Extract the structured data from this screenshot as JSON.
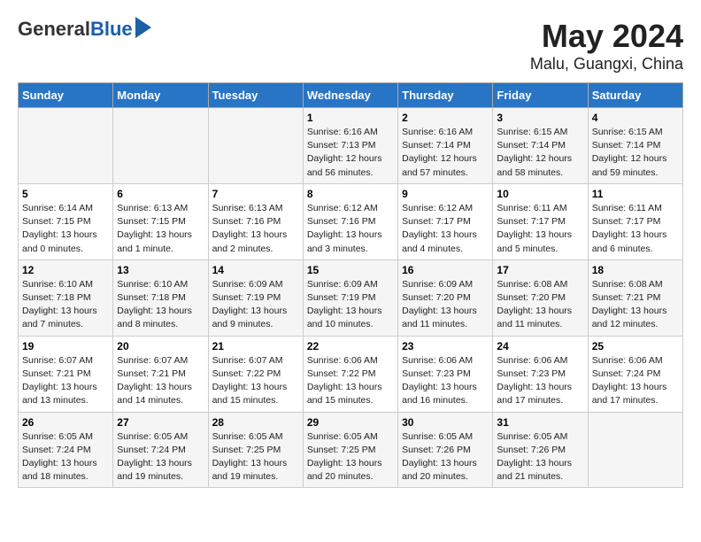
{
  "header": {
    "logo_general": "General",
    "logo_blue": "Blue",
    "title": "May 2024",
    "location": "Malu, Guangxi, China"
  },
  "weekdays": [
    "Sunday",
    "Monday",
    "Tuesday",
    "Wednesday",
    "Thursday",
    "Friday",
    "Saturday"
  ],
  "weeks": [
    [
      {
        "day": "",
        "info": ""
      },
      {
        "day": "",
        "info": ""
      },
      {
        "day": "",
        "info": ""
      },
      {
        "day": "1",
        "info": "Sunrise: 6:16 AM\nSunset: 7:13 PM\nDaylight: 12 hours\nand 56 minutes."
      },
      {
        "day": "2",
        "info": "Sunrise: 6:16 AM\nSunset: 7:14 PM\nDaylight: 12 hours\nand 57 minutes."
      },
      {
        "day": "3",
        "info": "Sunrise: 6:15 AM\nSunset: 7:14 PM\nDaylight: 12 hours\nand 58 minutes."
      },
      {
        "day": "4",
        "info": "Sunrise: 6:15 AM\nSunset: 7:14 PM\nDaylight: 12 hours\nand 59 minutes."
      }
    ],
    [
      {
        "day": "5",
        "info": "Sunrise: 6:14 AM\nSunset: 7:15 PM\nDaylight: 13 hours\nand 0 minutes."
      },
      {
        "day": "6",
        "info": "Sunrise: 6:13 AM\nSunset: 7:15 PM\nDaylight: 13 hours\nand 1 minute."
      },
      {
        "day": "7",
        "info": "Sunrise: 6:13 AM\nSunset: 7:16 PM\nDaylight: 13 hours\nand 2 minutes."
      },
      {
        "day": "8",
        "info": "Sunrise: 6:12 AM\nSunset: 7:16 PM\nDaylight: 13 hours\nand 3 minutes."
      },
      {
        "day": "9",
        "info": "Sunrise: 6:12 AM\nSunset: 7:17 PM\nDaylight: 13 hours\nand 4 minutes."
      },
      {
        "day": "10",
        "info": "Sunrise: 6:11 AM\nSunset: 7:17 PM\nDaylight: 13 hours\nand 5 minutes."
      },
      {
        "day": "11",
        "info": "Sunrise: 6:11 AM\nSunset: 7:17 PM\nDaylight: 13 hours\nand 6 minutes."
      }
    ],
    [
      {
        "day": "12",
        "info": "Sunrise: 6:10 AM\nSunset: 7:18 PM\nDaylight: 13 hours\nand 7 minutes."
      },
      {
        "day": "13",
        "info": "Sunrise: 6:10 AM\nSunset: 7:18 PM\nDaylight: 13 hours\nand 8 minutes."
      },
      {
        "day": "14",
        "info": "Sunrise: 6:09 AM\nSunset: 7:19 PM\nDaylight: 13 hours\nand 9 minutes."
      },
      {
        "day": "15",
        "info": "Sunrise: 6:09 AM\nSunset: 7:19 PM\nDaylight: 13 hours\nand 10 minutes."
      },
      {
        "day": "16",
        "info": "Sunrise: 6:09 AM\nSunset: 7:20 PM\nDaylight: 13 hours\nand 11 minutes."
      },
      {
        "day": "17",
        "info": "Sunrise: 6:08 AM\nSunset: 7:20 PM\nDaylight: 13 hours\nand 11 minutes."
      },
      {
        "day": "18",
        "info": "Sunrise: 6:08 AM\nSunset: 7:21 PM\nDaylight: 13 hours\nand 12 minutes."
      }
    ],
    [
      {
        "day": "19",
        "info": "Sunrise: 6:07 AM\nSunset: 7:21 PM\nDaylight: 13 hours\nand 13 minutes."
      },
      {
        "day": "20",
        "info": "Sunrise: 6:07 AM\nSunset: 7:21 PM\nDaylight: 13 hours\nand 14 minutes."
      },
      {
        "day": "21",
        "info": "Sunrise: 6:07 AM\nSunset: 7:22 PM\nDaylight: 13 hours\nand 15 minutes."
      },
      {
        "day": "22",
        "info": "Sunrise: 6:06 AM\nSunset: 7:22 PM\nDaylight: 13 hours\nand 15 minutes."
      },
      {
        "day": "23",
        "info": "Sunrise: 6:06 AM\nSunset: 7:23 PM\nDaylight: 13 hours\nand 16 minutes."
      },
      {
        "day": "24",
        "info": "Sunrise: 6:06 AM\nSunset: 7:23 PM\nDaylight: 13 hours\nand 17 minutes."
      },
      {
        "day": "25",
        "info": "Sunrise: 6:06 AM\nSunset: 7:24 PM\nDaylight: 13 hours\nand 17 minutes."
      }
    ],
    [
      {
        "day": "26",
        "info": "Sunrise: 6:05 AM\nSunset: 7:24 PM\nDaylight: 13 hours\nand 18 minutes."
      },
      {
        "day": "27",
        "info": "Sunrise: 6:05 AM\nSunset: 7:24 PM\nDaylight: 13 hours\nand 19 minutes."
      },
      {
        "day": "28",
        "info": "Sunrise: 6:05 AM\nSunset: 7:25 PM\nDaylight: 13 hours\nand 19 minutes."
      },
      {
        "day": "29",
        "info": "Sunrise: 6:05 AM\nSunset: 7:25 PM\nDaylight: 13 hours\nand 20 minutes."
      },
      {
        "day": "30",
        "info": "Sunrise: 6:05 AM\nSunset: 7:26 PM\nDaylight: 13 hours\nand 20 minutes."
      },
      {
        "day": "31",
        "info": "Sunrise: 6:05 AM\nSunset: 7:26 PM\nDaylight: 13 hours\nand 21 minutes."
      },
      {
        "day": "",
        "info": ""
      }
    ]
  ]
}
